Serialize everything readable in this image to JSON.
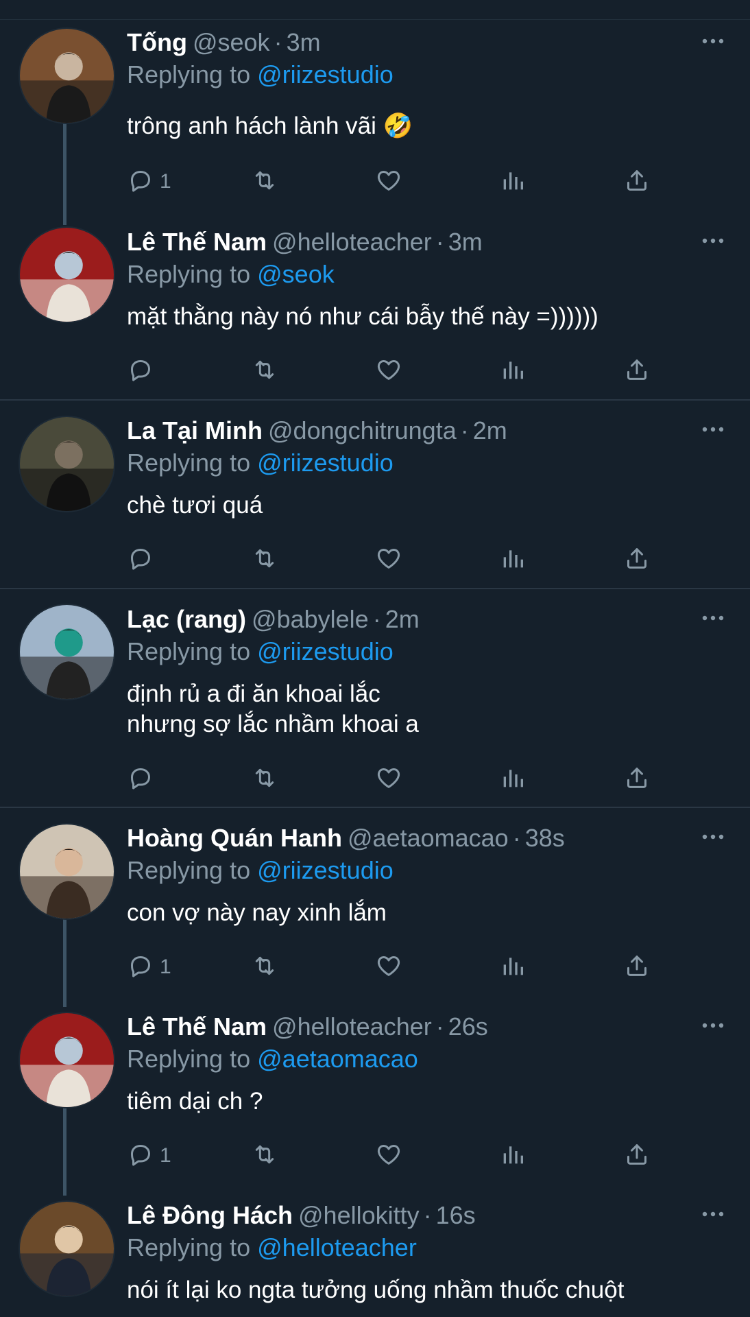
{
  "tweets": [
    {
      "name": "Tống",
      "handle": "@seok",
      "time": "3m",
      "replying_prefix": "Replying to",
      "replying_to": "@riizestudio",
      "text": "trông anh hách lành vãi 🤣",
      "reply_count": "1",
      "avatar_colors": [
        "#7a5030",
        "#c9b5a0",
        "#1a1a1a"
      ]
    },
    {
      "name": "Lê Thế Nam",
      "handle": "@helloteacher",
      "time": "3m",
      "replying_prefix": "Replying to",
      "replying_to": "@seok",
      "text": "mặt thằng này nó như cái bẫy thế này =))))))",
      "reply_count": "",
      "avatar_colors": [
        "#9b1c1c",
        "#b7c7d6",
        "#e9e2d8"
      ]
    },
    {
      "name": "La Tại Minh",
      "handle": "@dongchitrungta",
      "time": "2m",
      "replying_prefix": "Replying to",
      "replying_to": "@riizestudio",
      "text": "chè tươi quá",
      "reply_count": "",
      "avatar_colors": [
        "#4a4a3a",
        "#7c7060",
        "#111111"
      ]
    },
    {
      "name": "Lạc (rang)",
      "handle": "@babylele",
      "time": "2m",
      "replying_prefix": "Replying to",
      "replying_to": "@riizestudio",
      "text": "định rủ a đi ăn khoai lắc\nnhưng sợ lắc nhầm khoai a",
      "reply_count": "",
      "avatar_colors": [
        "#9fb4c9",
        "#1f9a8a",
        "#222222"
      ]
    },
    {
      "name": "Hoàng Quán Hanh",
      "handle": "@aetaomacao",
      "time": "38s",
      "replying_prefix": "Replying to",
      "replying_to": "@riizestudio",
      "text": "con vợ này nay xinh lắm",
      "reply_count": "1",
      "avatar_colors": [
        "#cfc4b4",
        "#d9b79a",
        "#3a2c22"
      ]
    },
    {
      "name": "Lê Thế Nam",
      "handle": "@helloteacher",
      "time": "26s",
      "replying_prefix": "Replying to",
      "replying_to": "@aetaomacao",
      "text": "tiêm dại ch ?",
      "reply_count": "1",
      "avatar_colors": [
        "#9b1c1c",
        "#b7c7d6",
        "#e9e2d8"
      ]
    },
    {
      "name": "Lê Đông Hách",
      "handle": "@hellokitty",
      "time": "16s",
      "replying_prefix": "Replying to",
      "replying_to": "@helloteacher",
      "text": "nói ít lại ko ngta tưởng uống nhầm thuốc chuột",
      "reply_count": "",
      "avatar_colors": [
        "#6b4a2a",
        "#e0c6a6",
        "#1c2433"
      ]
    }
  ],
  "icons": [
    "reply-icon",
    "retweet-icon",
    "like-icon",
    "analytics-icon",
    "share-icon",
    "more-icon"
  ],
  "colors": {
    "background": "#15202b",
    "text": "#ffffff",
    "muted": "#8899a6",
    "link": "#1d9bf0",
    "divider": "#2a3744"
  }
}
